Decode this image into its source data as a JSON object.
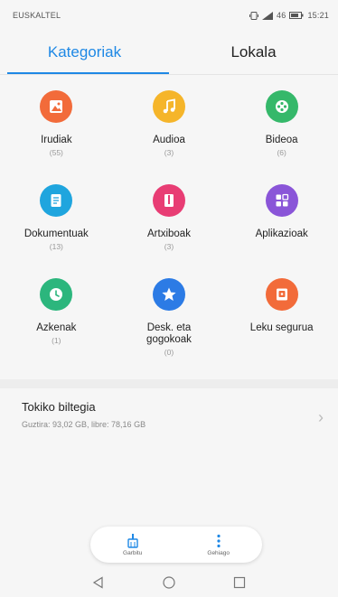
{
  "status_bar": {
    "carrier": "EUSKALTEL",
    "indicators": "46",
    "time": "15:21"
  },
  "tabs": [
    {
      "label": "Kategoriak",
      "active": true
    },
    {
      "label": "Lokala",
      "active": false
    }
  ],
  "categories": [
    {
      "label": "Irudiak",
      "count": "(55)",
      "color": "#f26b3a",
      "icon": "image-icon"
    },
    {
      "label": "Audioa",
      "count": "(3)",
      "color": "#f5b52a",
      "icon": "music-icon"
    },
    {
      "label": "Bideoa",
      "count": "(6)",
      "color": "#35b86a",
      "icon": "video-icon"
    },
    {
      "label": "Dokumentuak",
      "count": "(13)",
      "color": "#1fa5de",
      "icon": "document-icon"
    },
    {
      "label": "Artxiboak",
      "count": "(3)",
      "color": "#e83d74",
      "icon": "archive-icon"
    },
    {
      "label": "Aplikazioak",
      "count": "",
      "color": "#8a55d8",
      "icon": "apps-icon"
    },
    {
      "label": "Azkenak",
      "count": "(1)",
      "color": "#2cb67d",
      "icon": "clock-icon"
    },
    {
      "label": "Desk. eta gogokoak",
      "count": "(0)",
      "color": "#2c7be5",
      "icon": "star-icon"
    },
    {
      "label": "Leku segurua",
      "count": "",
      "color": "#f26b3a",
      "icon": "safe-icon"
    }
  ],
  "storage": {
    "title": "Tokiko biltegia",
    "subtitle": "Guztira: 93,02 GB, libre: 78,16 GB"
  },
  "bottom_bar": {
    "left_label": "Garbitu",
    "right_label": "Gehiago"
  }
}
